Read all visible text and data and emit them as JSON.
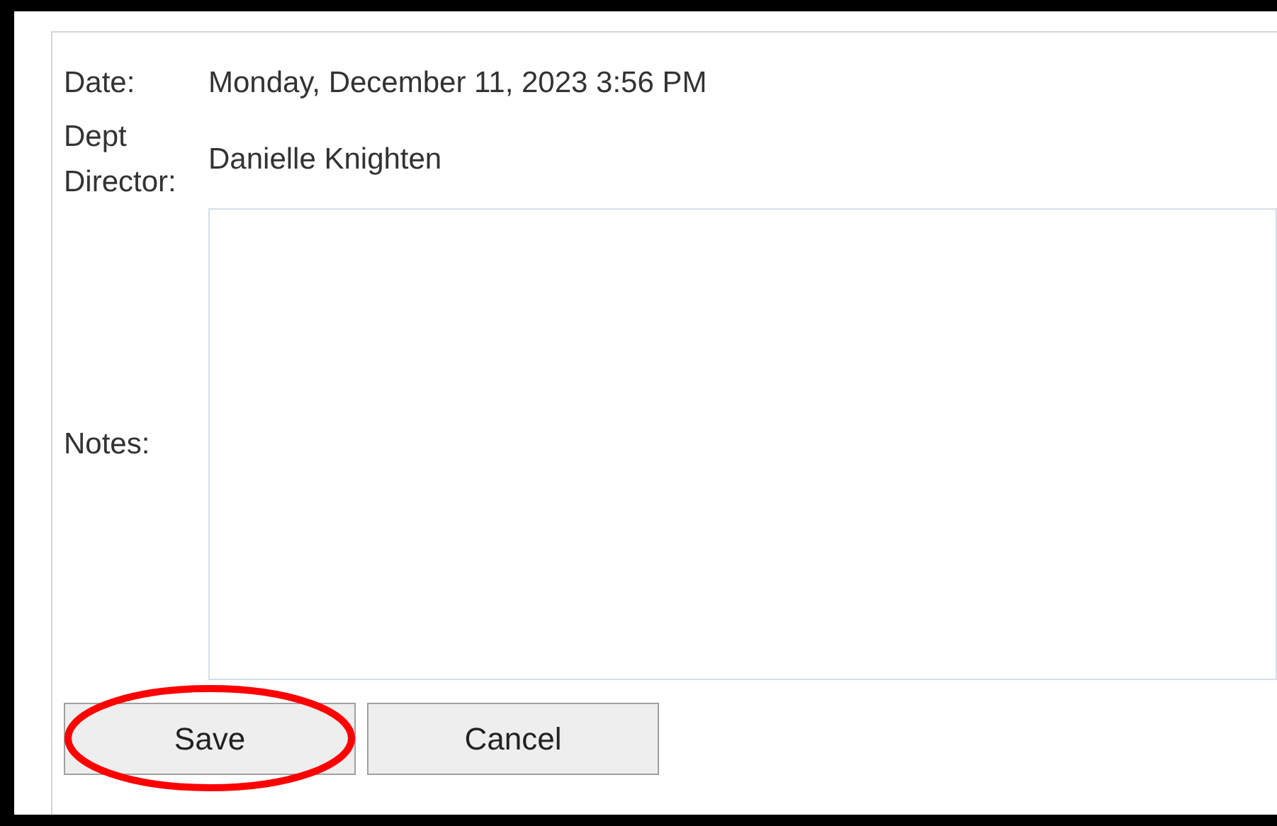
{
  "fields": [
    {
      "label": "Date:",
      "value": "Monday, December 11, 2023 3:56 PM"
    },
    {
      "label": "Dept Director:",
      "value": "Danielle Knighten"
    }
  ],
  "notes": {
    "label": "Notes:"
  },
  "buttons": [
    {
      "label": "Save",
      "highlighted": true
    },
    {
      "label": "Cancel",
      "highlighted": false
    }
  ]
}
